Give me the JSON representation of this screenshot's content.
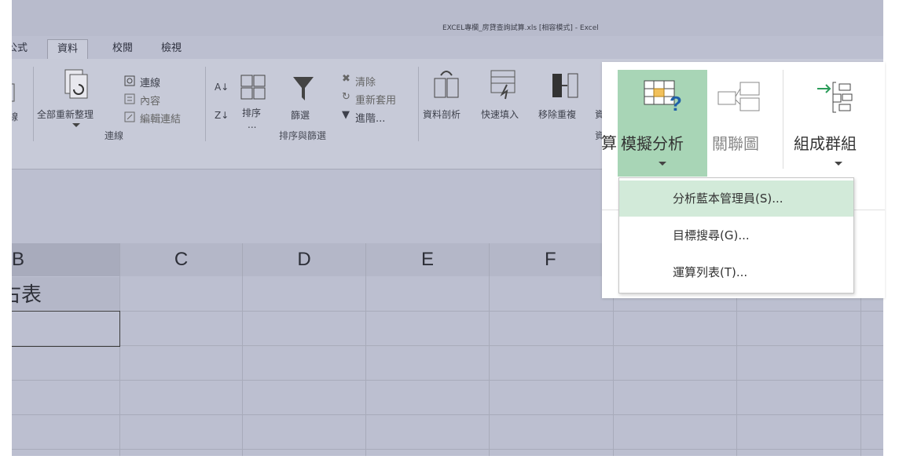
{
  "window": {
    "title": "EXCEL專欄_房貸查詢試算.xls  [相容模式] - Excel"
  },
  "tabs": [
    {
      "label": "公式"
    },
    {
      "label": "資料",
      "active": true
    },
    {
      "label": "校閱"
    },
    {
      "label": "檢視"
    }
  ],
  "ribbon": {
    "connections_partial": "線",
    "refresh_all": "全部重新整理",
    "connections": "連線",
    "properties": "內容",
    "edit_links": "編輯連結",
    "group_connections": "連線",
    "sort": "排序",
    "sort_more": "...",
    "filter": "篩選",
    "clear": "清除",
    "reapply": "重新套用",
    "advanced": "進階...",
    "group_sort_filter": "排序與篩選",
    "text_to_columns": "資料剖析",
    "flash_fill": "快速填入",
    "remove_duplicates": "移除重複",
    "partial_validation": "資",
    "group_data_tools_partial": "資",
    "partial_calc": "算"
  },
  "popup": {
    "what_if": "模擬分析",
    "relationships": "關聯圖",
    "group": "組成群組"
  },
  "menu": {
    "items": [
      {
        "label": "分析藍本管理員(S)..."
      },
      {
        "label": "目標搜尋(G)..."
      },
      {
        "label": "運算列表(T)..."
      }
    ]
  },
  "sheet": {
    "columns": [
      "B",
      "C",
      "D",
      "E",
      "F"
    ],
    "cell_b1": "古表"
  },
  "colors": {
    "highlight": "#a8d5b6",
    "menu_hover": "#d2ead9",
    "dim": "#bcbfd0"
  }
}
